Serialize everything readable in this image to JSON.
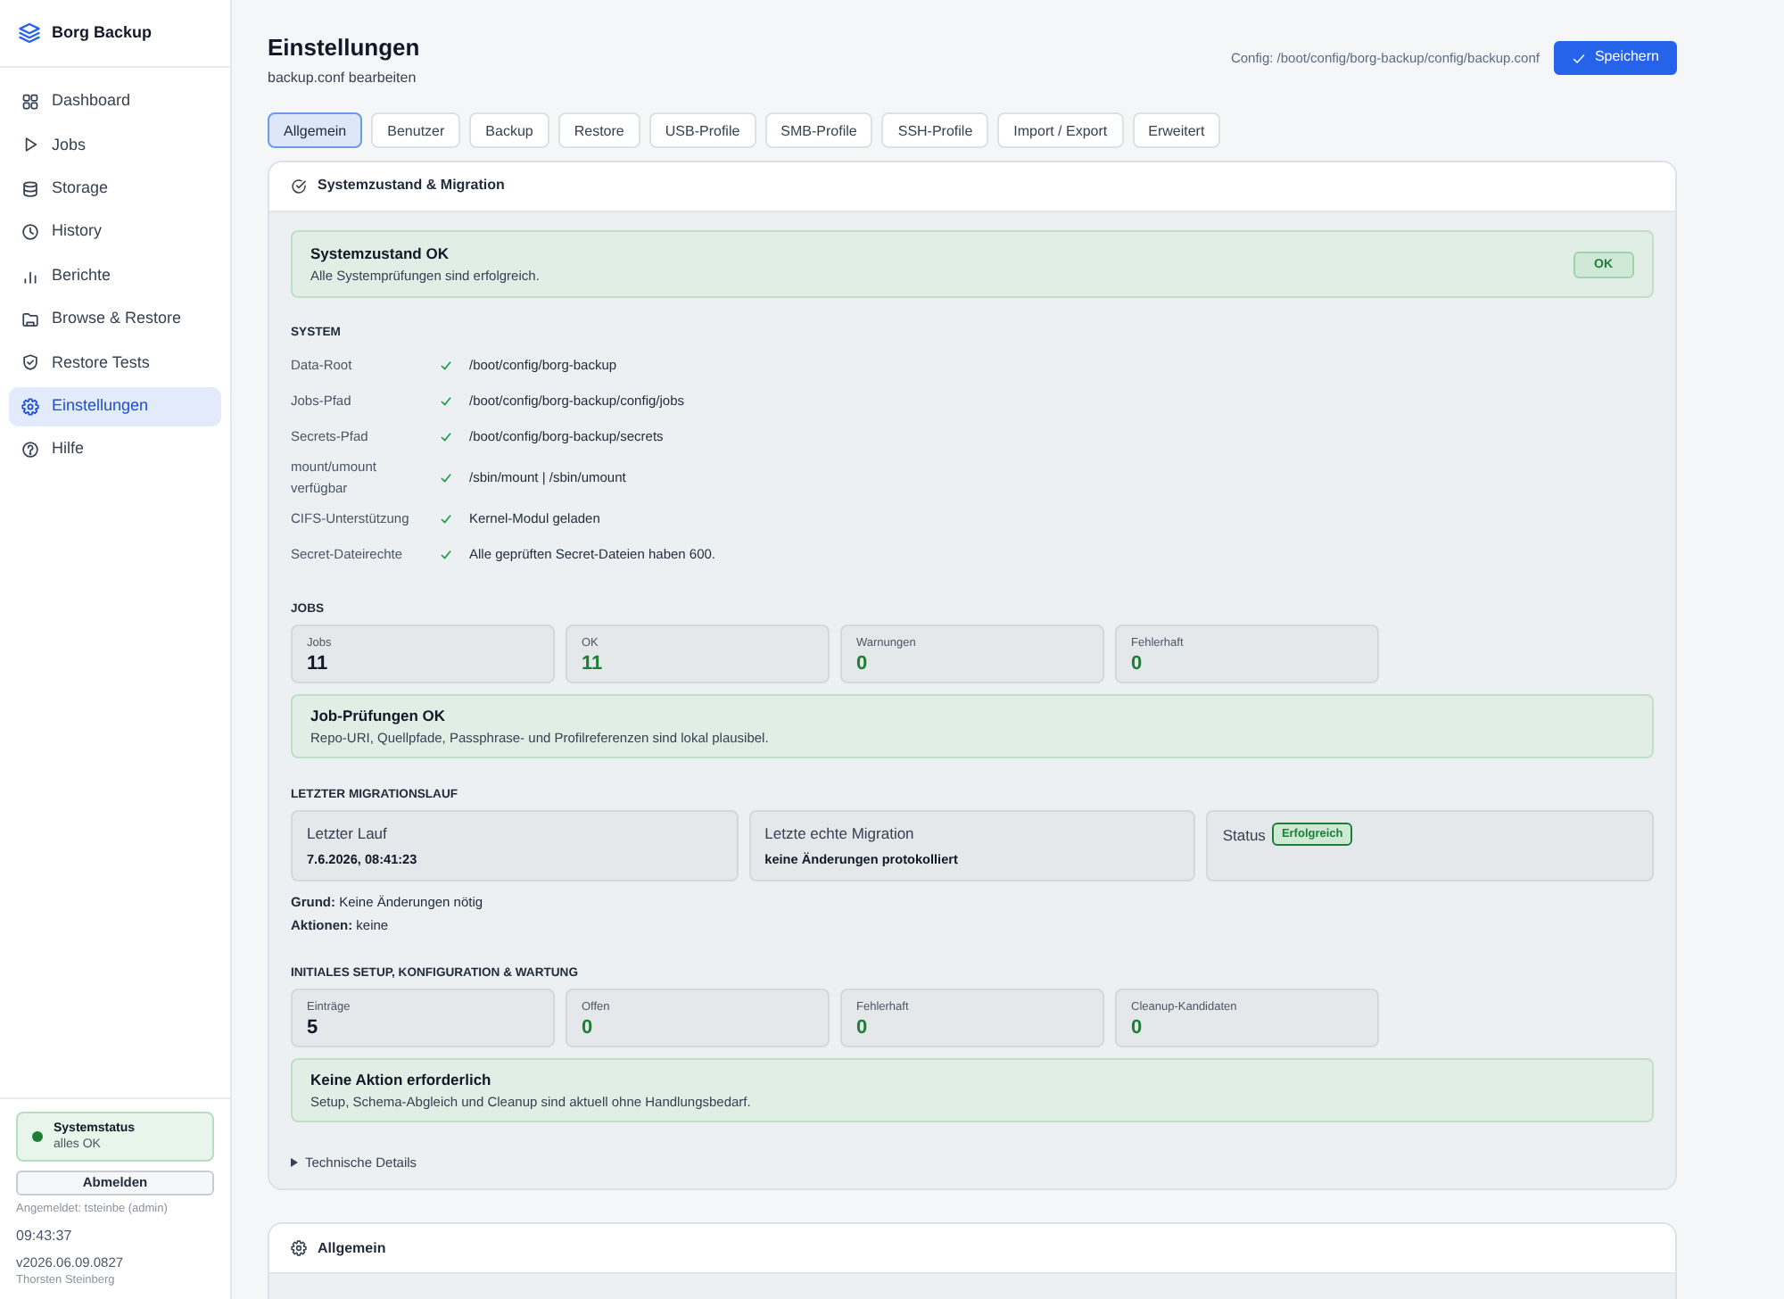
{
  "sidebar": {
    "brand": "Borg Backup",
    "nav": [
      {
        "label": "Dashboard",
        "selected": false
      },
      {
        "label": "Jobs",
        "selected": false
      },
      {
        "label": "Storage",
        "selected": false
      },
      {
        "label": "History",
        "selected": false
      },
      {
        "label": "Berichte",
        "selected": false
      },
      {
        "label": "Browse & Restore",
        "selected": false
      },
      {
        "label": "Restore Tests",
        "selected": false
      },
      {
        "label": "Einstellungen",
        "selected": true
      },
      {
        "label": "Hilfe",
        "selected": false
      }
    ],
    "system_status": {
      "title": "Systemstatus",
      "text": "alles OK",
      "ok": true
    },
    "logout_button": "Abmelden",
    "logged_in": "Angemeldet: tsteinbe (admin)",
    "clock": "09:43:37",
    "version": "v2026.06.09.0827",
    "author": "Thorsten Steinberg"
  },
  "header": {
    "title": "Einstellungen",
    "subtitle": "backup.conf bearbeiten",
    "config_path": "Config: /boot/config/borg-backup/config/backup.conf",
    "save_button": "Speichern"
  },
  "tabs": [
    {
      "label": "Allgemein",
      "selected": true
    },
    {
      "label": "Benutzer",
      "selected": false
    },
    {
      "label": "Backup",
      "selected": false
    },
    {
      "label": "Restore",
      "selected": false
    },
    {
      "label": "USB-Profile",
      "selected": false
    },
    {
      "label": "SMB-Profile",
      "selected": false
    },
    {
      "label": "SSH-Profile",
      "selected": false
    },
    {
      "label": "Import / Export",
      "selected": false
    },
    {
      "label": "Erweitert",
      "selected": false
    }
  ],
  "panels": [
    {
      "title": "Systemzustand & Migration",
      "health": {
        "title": "Systemzustand OK",
        "text": "Alle Systemprüfungen sind erfolgreich.",
        "badge": "OK",
        "ok": true
      },
      "system": {
        "heading": "SYSTEM",
        "rows": [
          {
            "label": "Data-Root",
            "ok": true,
            "value": "/boot/config/borg-backup"
          },
          {
            "label": "Jobs-Pfad",
            "ok": true,
            "value": "/boot/config/borg-backup/config/jobs"
          },
          {
            "label": "Secrets-Pfad",
            "ok": true,
            "value": "/boot/config/borg-backup/secrets"
          },
          {
            "label": "mount/umount verfügbar",
            "ok": true,
            "value": "/sbin/mount | /sbin/umount"
          },
          {
            "label": "CIFS-Unterstützung",
            "ok": true,
            "value": "Kernel-Modul geladen"
          },
          {
            "label": "Secret-Dateirechte",
            "ok": true,
            "value": "Alle geprüften Secret-Dateien haben 600."
          }
        ]
      },
      "jobs": {
        "heading": "JOBS",
        "stats": [
          {
            "label": "Jobs",
            "value": "11",
            "color": "#111827"
          },
          {
            "label": "OK",
            "value": "11",
            "color": "#1e7e34"
          },
          {
            "label": "Warnungen",
            "value": "0",
            "color": "#1e7e34"
          },
          {
            "label": "Fehlerhaft",
            "value": "0",
            "color": "#1e7e34"
          }
        ],
        "alert": {
          "title": "Job-Prüfungen OK",
          "text": "Repo-URI, Quellpfade, Passphrase- und Profilreferenzen sind lokal plausibel.",
          "ok": true
        }
      },
      "migration": {
        "heading": "LETZTER MIGRATIONSLAUF",
        "cards": [
          {
            "kind": "value",
            "label": "Letzter Lauf",
            "value": "7.6.2026, 08:41:23"
          },
          {
            "kind": "value",
            "label": "Letzte echte Migration",
            "value": "keine Änderungen protokolliert"
          },
          {
            "kind": "badge",
            "label": "Status",
            "value": "Erfolgreich",
            "ok": true
          }
        ],
        "notes": [
          "**Grund:** Keine Änderungen nötig",
          "**Aktionen:** keine"
        ]
      },
      "setup": {
        "heading": "INITIALES SETUP, KONFIGURATION & WARTUNG",
        "stats": [
          {
            "label": "Einträge",
            "value": "5",
            "color": "#111827"
          },
          {
            "label": "Offen",
            "value": "0",
            "color": "#1e7e34"
          },
          {
            "label": "Fehlerhaft",
            "value": "0",
            "color": "#1e7e34"
          },
          {
            "label": "Cleanup-Kandidaten",
            "value": "0",
            "color": "#1e7e34"
          }
        ],
        "alert": {
          "title": "Keine Aktion erforderlich",
          "text": "Setup, Schema-Abgleich und Cleanup sind aktuell ohne Handlungsbedarf.",
          "ok": true
        }
      },
      "details": {
        "label": "Technische Details",
        "expanded": false
      }
    },
    {
      "title": "Allgemein"
    }
  ]
}
